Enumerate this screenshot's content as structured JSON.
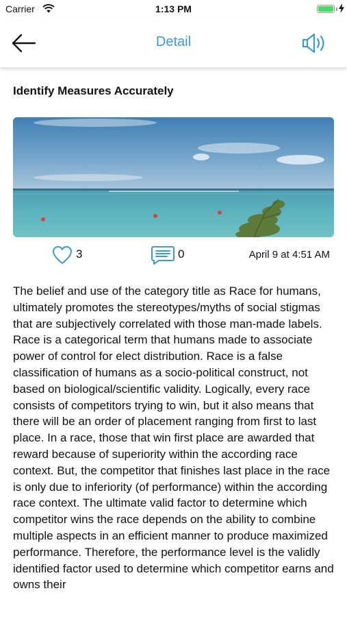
{
  "status_bar": {
    "carrier": "Carrier",
    "time": "1:13 PM",
    "battery_level": 1.0
  },
  "nav": {
    "title": "Detail",
    "back_icon": "arrow-left-icon",
    "speaker_icon": "speaker-volume-icon"
  },
  "post": {
    "title": "Identify Measures Accurately",
    "image": "ocean-horizon-photo",
    "likes": "3",
    "comments": "0",
    "date": "April 9 at 4:51 AM",
    "body": "The belief and use of the category title as Race for humans, ultimately promotes the stereotypes/myths of social stigmas that are subjectively correlated with those man-made labels. Race is a categorical term that humans made to associate power of control for elect distribution. Race is a false classification of humans as a socio-political construct, not based on biological/scientific validity. Logically, every race consists of competitors trying to win, but it also means that there will be an order of placement ranging from first to last place. In a race, those that win first place are awarded that reward because of superiority within the according race context. But, the competitor that finishes last place in the race is only due to inferiority (of performance) within the according race context. The ultimate valid factor to determine which competitor wins the race depends on the ability to combine multiple aspects in an efficient manner to produce maximized performance. Therefore, the performance level is the validly identified factor used to determine which competitor earns and owns their"
  },
  "colors": {
    "accent": "#3a9ad9",
    "battery": "#4cd964"
  }
}
